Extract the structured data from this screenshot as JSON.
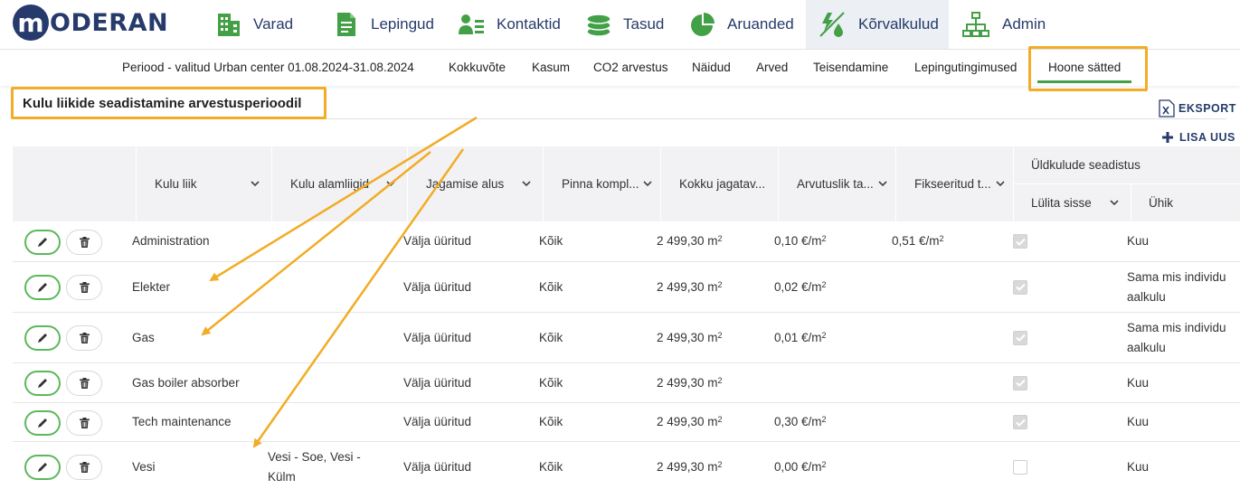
{
  "brand": {
    "logo_letter": "m",
    "logo_text": "ODERAN"
  },
  "nav": {
    "items": [
      {
        "label": "Varad",
        "icon": "building-icon"
      },
      {
        "label": "Lepingud",
        "icon": "document-icon"
      },
      {
        "label": "Kontaktid",
        "icon": "contacts-icon"
      },
      {
        "label": "Tasud",
        "icon": "coins-icon"
      },
      {
        "label": "Aruanded",
        "icon": "pie-chart-icon"
      },
      {
        "label": "Kõrvalkulud",
        "icon": "utilities-icon",
        "active": true
      },
      {
        "label": "Admin",
        "icon": "org-chart-icon"
      }
    ]
  },
  "subnav": {
    "period": "Periood - valitud Urban center 01.08.2024-31.08.2024",
    "tabs": [
      "Kokkuvõte",
      "Kasum",
      "CO2 arvestus",
      "Näidud",
      "Arved",
      "Teisendamine",
      "Lepingutingimused",
      "Hoone sätted"
    ],
    "active_tab": "Hoone sätted"
  },
  "page": {
    "title": "Kulu liikide seadistamine arvestusperioodil",
    "export_label": "EKSPORT",
    "add_label": "LISA UUS"
  },
  "table": {
    "columns": {
      "kulu_liik": "Kulu liik",
      "alamliigid": "Kulu alamliigid",
      "jagamise_alus": "Jagamise alus",
      "pinna_kompl": "Pinna kompl...",
      "kokku": "Kokku jagatav...",
      "arvutuslik": "Arvutuslik ta...",
      "fikseeritud": "Fikseeritud t...",
      "group": "Üldkulude seadistus",
      "lulita": "Lülita sisse",
      "uhik": "Ühik"
    },
    "rows": [
      {
        "kulu_liik": "Administration",
        "alamliigid": "",
        "jagamise_alus": "Välja üüritud",
        "pinna": "Kõik",
        "kokku": "2 499,30 m",
        "arvutuslik": "0,10 €/m",
        "fikseeritud": "0,51 €/m",
        "lulita": true,
        "uhik": "Kuu"
      },
      {
        "kulu_liik": "Elekter",
        "alamliigid": "",
        "jagamise_alus": "Välja üüritud",
        "pinna": "Kõik",
        "kokku": "2 499,30 m",
        "arvutuslik": "0,02 €/m",
        "fikseeritud": "",
        "lulita": true,
        "uhik": "Sama mis individuaalkulu"
      },
      {
        "kulu_liik": "Gas",
        "alamliigid": "",
        "jagamise_alus": "Välja üüritud",
        "pinna": "Kõik",
        "kokku": "2 499,30 m",
        "arvutuslik": "0,01 €/m",
        "fikseeritud": "",
        "lulita": true,
        "uhik": "Sama mis individuaalkulu"
      },
      {
        "kulu_liik": "Gas boiler absorber",
        "alamliigid": "",
        "jagamise_alus": "Välja üüritud",
        "pinna": "Kõik",
        "kokku": "2 499,30 m",
        "arvutuslik": "",
        "fikseeritud": "",
        "lulita": true,
        "uhik": "Kuu"
      },
      {
        "kulu_liik": "Tech maintenance",
        "alamliigid": "",
        "jagamise_alus": "Välja üüritud",
        "pinna": "Kõik",
        "kokku": "2 499,30 m",
        "arvutuslik": "0,30 €/m",
        "fikseeritud": "",
        "lulita": true,
        "uhik": "Kuu"
      },
      {
        "kulu_liik": "Vesi",
        "alamliigid": "Vesi - Soe, Vesi - Külm",
        "jagamise_alus": "Välja üüritud",
        "pinna": "Kõik",
        "kokku": "2 499,30 m",
        "arvutuslik": "0,00 €/m",
        "fikseeritud": "",
        "lulita": false,
        "uhik": "Kuu"
      }
    ],
    "unit_sup": "2"
  },
  "colors": {
    "brand": "#263b6b",
    "accent_green": "#43a047",
    "highlight": "#f2ac25",
    "header_bg": "#f2f2f5"
  }
}
